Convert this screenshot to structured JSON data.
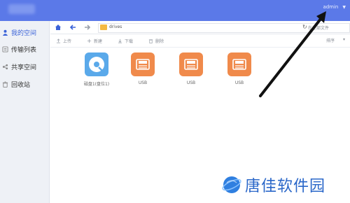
{
  "header": {
    "title": "",
    "user": "admin",
    "colors": {
      "bar": "#5b79e8"
    }
  },
  "sidebar": {
    "items": [
      {
        "label": "我的空间",
        "icon": "user-icon",
        "active": true
      },
      {
        "label": "传输列表",
        "icon": "transfer-icon",
        "active": false
      },
      {
        "label": "共享空间",
        "icon": "share-icon",
        "active": false
      },
      {
        "label": "回收站",
        "icon": "trash-icon",
        "active": false
      }
    ]
  },
  "toolbar": {
    "path": "drives",
    "search_placeholder": "在全部文件"
  },
  "actions": {
    "upload": "上传",
    "create": "新建",
    "download": "下载",
    "delete": "删除",
    "sort": "排序"
  },
  "files": [
    {
      "name": "磁盘1(盘位1)",
      "icon": "disk-icon",
      "color": "#5aa9ea"
    },
    {
      "name": "USB",
      "icon": "usb-drive-icon",
      "color": "#f08a4b"
    },
    {
      "name": "USB",
      "icon": "usb-drive-icon",
      "color": "#f08a4b"
    },
    {
      "name": "USB",
      "icon": "usb-drive-icon",
      "color": "#f08a4b"
    }
  ],
  "watermark": {
    "text": "唐佳软件园"
  }
}
